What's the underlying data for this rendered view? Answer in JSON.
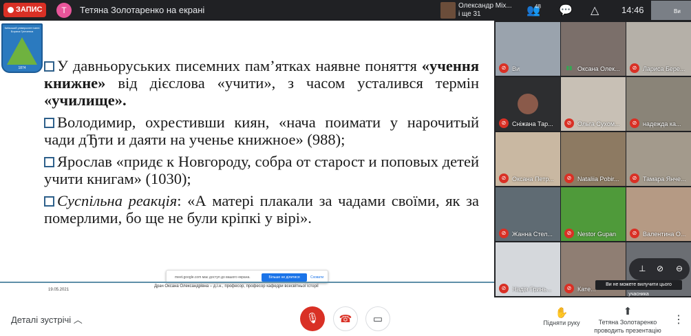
{
  "topbar": {
    "recording_label": "ЗАПИС",
    "presenter_initial": "Т",
    "presenter_title": "Тетяна Золотаренко на екрані",
    "host_name": "Олександр Міх...",
    "host_more": "і ще 31",
    "participants_count": "48",
    "time": "14:46",
    "self_label": "Ви"
  },
  "slide": {
    "logo_text": "Київський університет імені Бориса Грінченка",
    "logo_year": "1874",
    "p1": {
      "t1": "У давньоруських писемних пам’ятках наявне поняття ",
      "b1": "«учення книжне»",
      "t2": " від дієслова «учити», з часом усталився термін ",
      "b2": "«училище»."
    },
    "p2": "Володимир, охрестивши киян, «нача поимати у нарочитый чади дЂти и даяти на ученье книжное» (988);",
    "p3": "Ярослав «придє к Новгороду, собра от старост и поповых детей учити книгам» (1030);",
    "p4": {
      "i": "Суспільна реакція",
      "t": ": «А матері плакали за чадами своїми, як за померлими, бо ще не були кріпкі у вірі»."
    },
    "footer_date": "19.05.2021",
    "footer_author": "Драч Оксана Олександрівна – д.і.н., професор, професор кафедри всесвітньої історії",
    "share_notice": "meet.google.com має доступ до вашого екрана.",
    "stop_share_label": "Більше не ділитися",
    "hide_label": "Сховати"
  },
  "participants": [
    {
      "name": "Ви",
      "muted": true,
      "bg": "#9aa3ad"
    },
    {
      "name": "Оксана Олек...",
      "muted": false,
      "bg": "#7b6f6a"
    },
    {
      "name": "Лариса Бере...",
      "muted": true,
      "bg": "#b5b0a8"
    },
    {
      "name": "Сніжана Тар...",
      "muted": true,
      "bg": "#2d2e30",
      "avatar": "#8a5a4a"
    },
    {
      "name": "Ольга Сухом...",
      "muted": true,
      "bg": "#c8c0b5"
    },
    {
      "name": "надежда ка...",
      "muted": true,
      "bg": "#8a8478"
    },
    {
      "name": "Оксана Петр...",
      "muted": true,
      "bg": "#c9b8a2"
    },
    {
      "name": "Nataliia Pobir...",
      "muted": true,
      "bg": "#8d7a62"
    },
    {
      "name": "Тамара Янче...",
      "muted": true,
      "bg": "#a39a8c"
    },
    {
      "name": "Жанна Стел...",
      "muted": true,
      "bg": "#5f6b73"
    },
    {
      "name": "Nestor Gupan",
      "muted": true,
      "bg": "#4f9a3a"
    },
    {
      "name": "Валентина О...",
      "muted": true,
      "bg": "#b59a84"
    },
    {
      "name": "Надія Гринь...",
      "muted": true,
      "bg": "#d5d8dc"
    },
    {
      "name": "Кате...",
      "muted": true,
      "bg": "#8f7e73"
    },
    {
      "name": "",
      "muted": false,
      "bg": "#6b6e73"
    }
  ],
  "participant_tooltip": "Ви не можете вилучити цього учасника",
  "bottombar": {
    "details_label": "Деталі зустрічі",
    "raise_hand_label": "Підняти руку",
    "presenting_line1": "Тетяна Золотаренко",
    "presenting_line2": "проводить презентацію"
  },
  "colors": {
    "record": "#d93025",
    "mic_off": "#d93025",
    "accent": "#1a73e8"
  }
}
